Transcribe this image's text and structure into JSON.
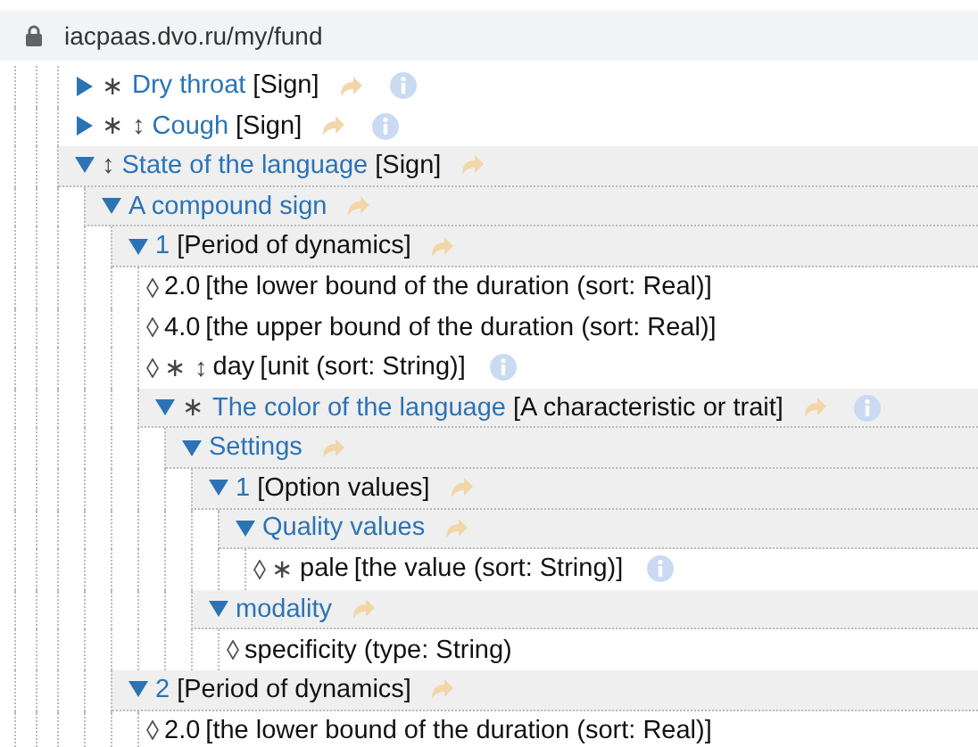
{
  "address_bar": {
    "url": "iacpaas.dvo.ru/my/fund"
  },
  "tree": [
    {
      "kind": "folder",
      "expanded": false,
      "marks": "∗",
      "name": "Dry throat",
      "type": "[Sign]",
      "link": true,
      "info": true
    },
    {
      "kind": "folder",
      "expanded": false,
      "marks": "∗ ↕",
      "name": "Cough",
      "type": "[Sign]",
      "link": true,
      "info": true
    },
    {
      "kind": "folder",
      "expanded": true,
      "marks": "↕",
      "name": "State of the language",
      "type": "[Sign]",
      "link": true,
      "info": false,
      "children": [
        {
          "kind": "folder",
          "expanded": true,
          "name": "A compound sign",
          "link": true,
          "info": false,
          "children": [
            {
              "kind": "folder",
              "expanded": true,
              "name": "1",
              "type": "[Period of dynamics]",
              "link": true,
              "info": false,
              "children": [
                {
                  "kind": "leaf",
                  "name": "2.0",
                  "type": "[the lower bound of the duration (sort: Real)]",
                  "link": false,
                  "info": false
                },
                {
                  "kind": "leaf",
                  "name": "4.0",
                  "type": "[the upper bound of the duration (sort: Real)]",
                  "link": false,
                  "info": false
                },
                {
                  "kind": "leaf",
                  "marks": "∗ ↕",
                  "name": "day",
                  "type": "[unit (sort: String)]",
                  "link": false,
                  "info": true
                },
                {
                  "kind": "folder",
                  "expanded": true,
                  "marks": "∗",
                  "name": "The color of the language",
                  "type": "[A characteristic or trait]",
                  "link": true,
                  "info": true,
                  "children": [
                    {
                      "kind": "folder",
                      "expanded": true,
                      "name": "Settings",
                      "link": true,
                      "info": false,
                      "children": [
                        {
                          "kind": "folder",
                          "expanded": true,
                          "name": "1",
                          "type": "[Option values]",
                          "link": true,
                          "info": false,
                          "children": [
                            {
                              "kind": "folder",
                              "expanded": true,
                              "name": "Quality values",
                              "link": true,
                              "info": false,
                              "children": [
                                {
                                  "kind": "leaf",
                                  "marks": "∗",
                                  "name": "pale",
                                  "type": "[the value (sort: String)]",
                                  "link": false,
                                  "info": true
                                }
                              ]
                            }
                          ]
                        },
                        {
                          "kind": "folder",
                          "expanded": true,
                          "name": "modality",
                          "link": true,
                          "info": false,
                          "children": [
                            {
                              "kind": "leaf",
                              "name": "specificity (type: String)",
                              "link": false,
                              "info": false
                            }
                          ]
                        }
                      ]
                    }
                  ]
                }
              ]
            },
            {
              "kind": "folder",
              "expanded": true,
              "name": "2",
              "type": "[Period of dynamics]",
              "link": true,
              "info": false,
              "children": [
                {
                  "kind": "leaf",
                  "name": "2.0",
                  "type": "[the lower bound of the duration (sort: Real)]",
                  "link": false,
                  "info": false
                }
              ]
            }
          ]
        }
      ]
    }
  ]
}
